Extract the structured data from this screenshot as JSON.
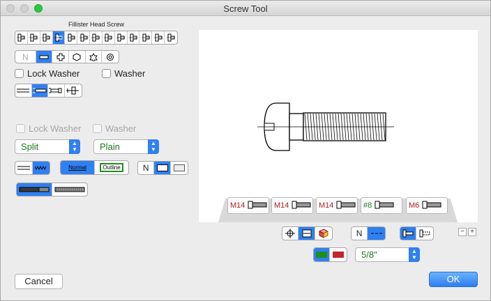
{
  "window": {
    "title": "Screw Tool"
  },
  "head_label": "Fillister Head Screw",
  "drive_letter": "N",
  "washer_row1": {
    "lock": "Lock Washer",
    "plain": "Washer"
  },
  "washer_row2": {
    "lock": "Lock Washer",
    "plain": "Washer"
  },
  "popups": {
    "lock_type": "Split",
    "washer_type": "Plain",
    "size": "5/8\""
  },
  "thread_buttons": {
    "normal": "Normal",
    "outline": "Outline"
  },
  "view_letter": "N",
  "bottom_n": "N",
  "presets": [
    {
      "label": "M14",
      "color": "#b22222"
    },
    {
      "label": "M14",
      "color": "#b22222"
    },
    {
      "label": "M14",
      "color": "#b22222"
    },
    {
      "label": "#8",
      "color": "#1e7a1e"
    },
    {
      "label": "M6",
      "color": "#b22222"
    }
  ],
  "stepper": {
    "minus": "−",
    "plus": "+"
  },
  "buttons": {
    "cancel": "Cancel",
    "ok": "OK"
  },
  "colors": {
    "accent": "#2f80f2",
    "green": "#1e8f1e",
    "red": "#c0272d"
  }
}
